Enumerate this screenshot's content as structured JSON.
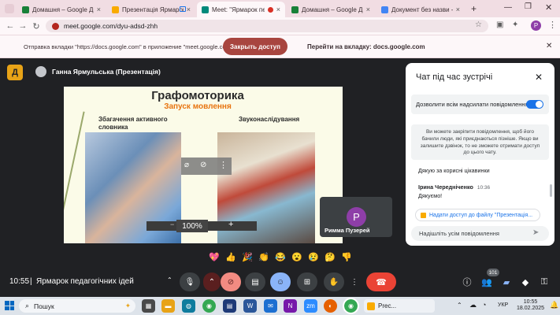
{
  "browser": {
    "tabs": [
      {
        "label": "Домашня – Google Диск",
        "color": "#188038"
      },
      {
        "label": "Презентація Ярмарок 2",
        "color": "#f9ab00"
      },
      {
        "label": "Meet: \"Ярмарок педаго",
        "color": "#00897b"
      },
      {
        "label": "Домашня – Google Диск",
        "color": "#188038"
      },
      {
        "label": "Документ без назви - Goo",
        "color": "#4285f4"
      }
    ],
    "new_tab": "+",
    "url": "meet.google.com/dyu-adsd-zhh",
    "profile_initial": "P"
  },
  "infobar": {
    "message": "Отправка вкладки \"https://docs.google.com\" в приложение \"meet.google.com\"...",
    "stop_button": "Закрыть доступ",
    "switch_link": "Перейти на вкладку: docs.google.com"
  },
  "meet": {
    "logo_letter": "Д",
    "presenter_title": "Ганна Ярмульська (Презентація)",
    "zoom_level": "100%",
    "slide": {
      "title": "Графомоторика",
      "subtitle": "Запуск мовлення",
      "left_caption": "Збагачення активного словника",
      "right_caption": "Звуконаслідування"
    },
    "self_tile": {
      "initial": "P",
      "name": "Римма Пузерей"
    },
    "chat": {
      "title": "Чат під час зустрічі",
      "allow_label": "Дозволити всім надсилати повідомлення",
      "notice": "Ви можете закріпити повідомлення, щоб його бачили люди, які приєднаються пізніше. Якщо ви залишите дзвінок, то не зможете отримати доступ до цього чату.",
      "prev_message": "Дякую за корисні цікавинки",
      "msg_sender": "Ірина Чередніченко",
      "msg_time": "10:36",
      "msg_text": "Дякуємо!",
      "link_chip": "Надати доступ до файлу \"Презентація...",
      "input_placeholder": "Надішліть усім повідомлення"
    },
    "reactions": [
      "💖",
      "👍",
      "🎉",
      "👏",
      "😂",
      "😮",
      "😢",
      "🤔",
      "👎"
    ],
    "clock": "10:55",
    "separator": "|",
    "meeting_name": "Ярмарок педагогічних ідей",
    "people_count": "101"
  },
  "taskbar": {
    "search_placeholder": "Пошук",
    "active_app": "Prec...",
    "lang": "УКР",
    "time": "10:55",
    "date": "18.02.2025"
  }
}
